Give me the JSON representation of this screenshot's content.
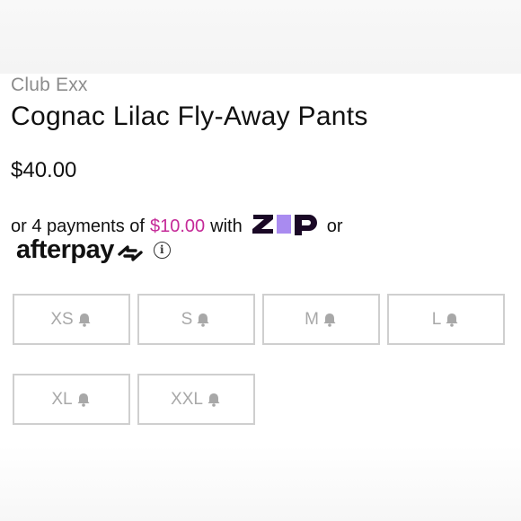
{
  "product": {
    "brand": "Club Exx",
    "title": "Cognac Lilac Fly-Away Pants",
    "price": "$40.00"
  },
  "payments": {
    "prefix": "or 4 payments of",
    "amount": "$10.00",
    "with": "with",
    "or": "or",
    "zip_logo_text": "zip",
    "afterpay_logo_text": "afterpay",
    "info_icon_glyph": "i",
    "amount_color": "#c52a98",
    "zip_accent_color": "#a98bf0"
  },
  "sizes": [
    {
      "label": "XS",
      "icon": "bell-icon"
    },
    {
      "label": "S",
      "icon": "bell-icon"
    },
    {
      "label": "M",
      "icon": "bell-icon"
    },
    {
      "label": "L",
      "icon": "bell-icon"
    },
    {
      "label": "XL",
      "icon": "bell-icon"
    },
    {
      "label": "XXL",
      "icon": "bell-icon"
    }
  ]
}
